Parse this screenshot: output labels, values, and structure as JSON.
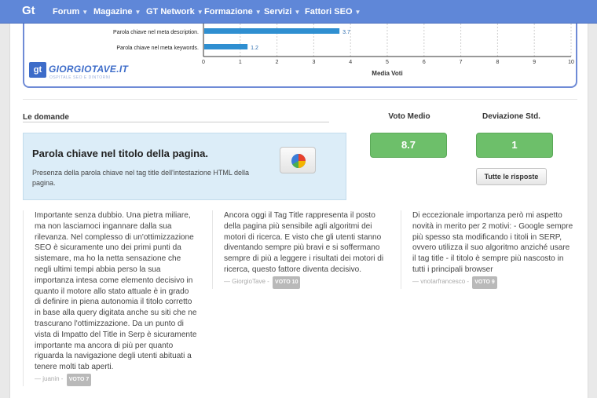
{
  "nav": {
    "logo": "Gt",
    "items": [
      {
        "label": "Forum"
      },
      {
        "label": "Magazine"
      },
      {
        "label": "GT Network"
      },
      {
        "label": "Formazione"
      },
      {
        "label": "Servizi"
      },
      {
        "label": "Fattori SEO"
      }
    ]
  },
  "chart_data": {
    "type": "bar",
    "orientation": "horizontal",
    "categories": [
      "Parola chiave nel meta description.",
      "Parola chiave nel meta keywords."
    ],
    "values": [
      3.7,
      1.2
    ],
    "data_labels": [
      "3.7",
      "1.2"
    ],
    "xlabel": "Media Voti",
    "xlim": [
      0,
      10
    ],
    "xticks": [
      "0",
      "1",
      "2",
      "3",
      "4",
      "5",
      "6",
      "7",
      "8",
      "9",
      "10"
    ],
    "grid": "vertical dashed",
    "bar_color": "#2f8fd1"
  },
  "brand": {
    "badge": "gt",
    "name": "GIORGIOTAVE.IT",
    "tagline": "OSPITALE SEO E DINTORNI"
  },
  "section": {
    "title": "Le domande"
  },
  "question": {
    "title": "Parola chiave nel titolo della pagina.",
    "description": "Presenza della parola chiave nel tag title dell'intestazione HTML della pagina.",
    "chart_button_icon": "pie-chart-icon"
  },
  "stats": {
    "mean_label": "Voto Medio",
    "mean_value": "8.7",
    "std_label": "Deviazione Std.",
    "std_value": "1",
    "all_answers_button": "Tutte le risposte",
    "box_color": "#6dbf6a"
  },
  "answers": [
    {
      "text": "Importante senza dubbio. Una pietra miliare, ma non lasciamoci ingannare dalla sua rilevanza. Nel complesso di un'ottimizzazione SEO è sicuramente uno dei primi punti da sistemare, ma ho la netta sensazione che negli ultimi tempi abbia perso la sua importanza intesa come elemento decisivo in quanto il motore allo stato attuale è in grado di definire in piena autonomia il titolo corretto in base alla query digitata anche su siti che ne trascurano l'ottimizzazione. Da un punto di vista di Impatto del Title in Serp è sicuramente importante ma ancora di più per quanto riguarda la navigazione degli utenti abituati a tenere molti tab aperti.",
      "author": "— juanin -",
      "vote": "VOTO 7"
    },
    {
      "text": "Ancora oggi il Tag Title rappresenta il posto della pagina più sensibile agli algoritmi dei motori di ricerca. E visto che gli utenti stanno diventando sempre più bravi e si soffermano sempre di più a leggere i risultati dei motori di ricerca, questo fattore diventa decisivo.",
      "author": "— GiorgioTave -",
      "vote": "VOTO 10"
    },
    {
      "text": "Di eccezionale importanza però mi aspetto novità in merito per 2 motivi: - Google sempre più spesso sta modificando i titoli in SERP, ovvero utilizza il suo algoritmo anziché usare il tag title - il titolo è sempre più nascosto in tutti i principali browser",
      "author": "— vnotarfrancesco -",
      "vote": "VOTO 9"
    }
  ]
}
